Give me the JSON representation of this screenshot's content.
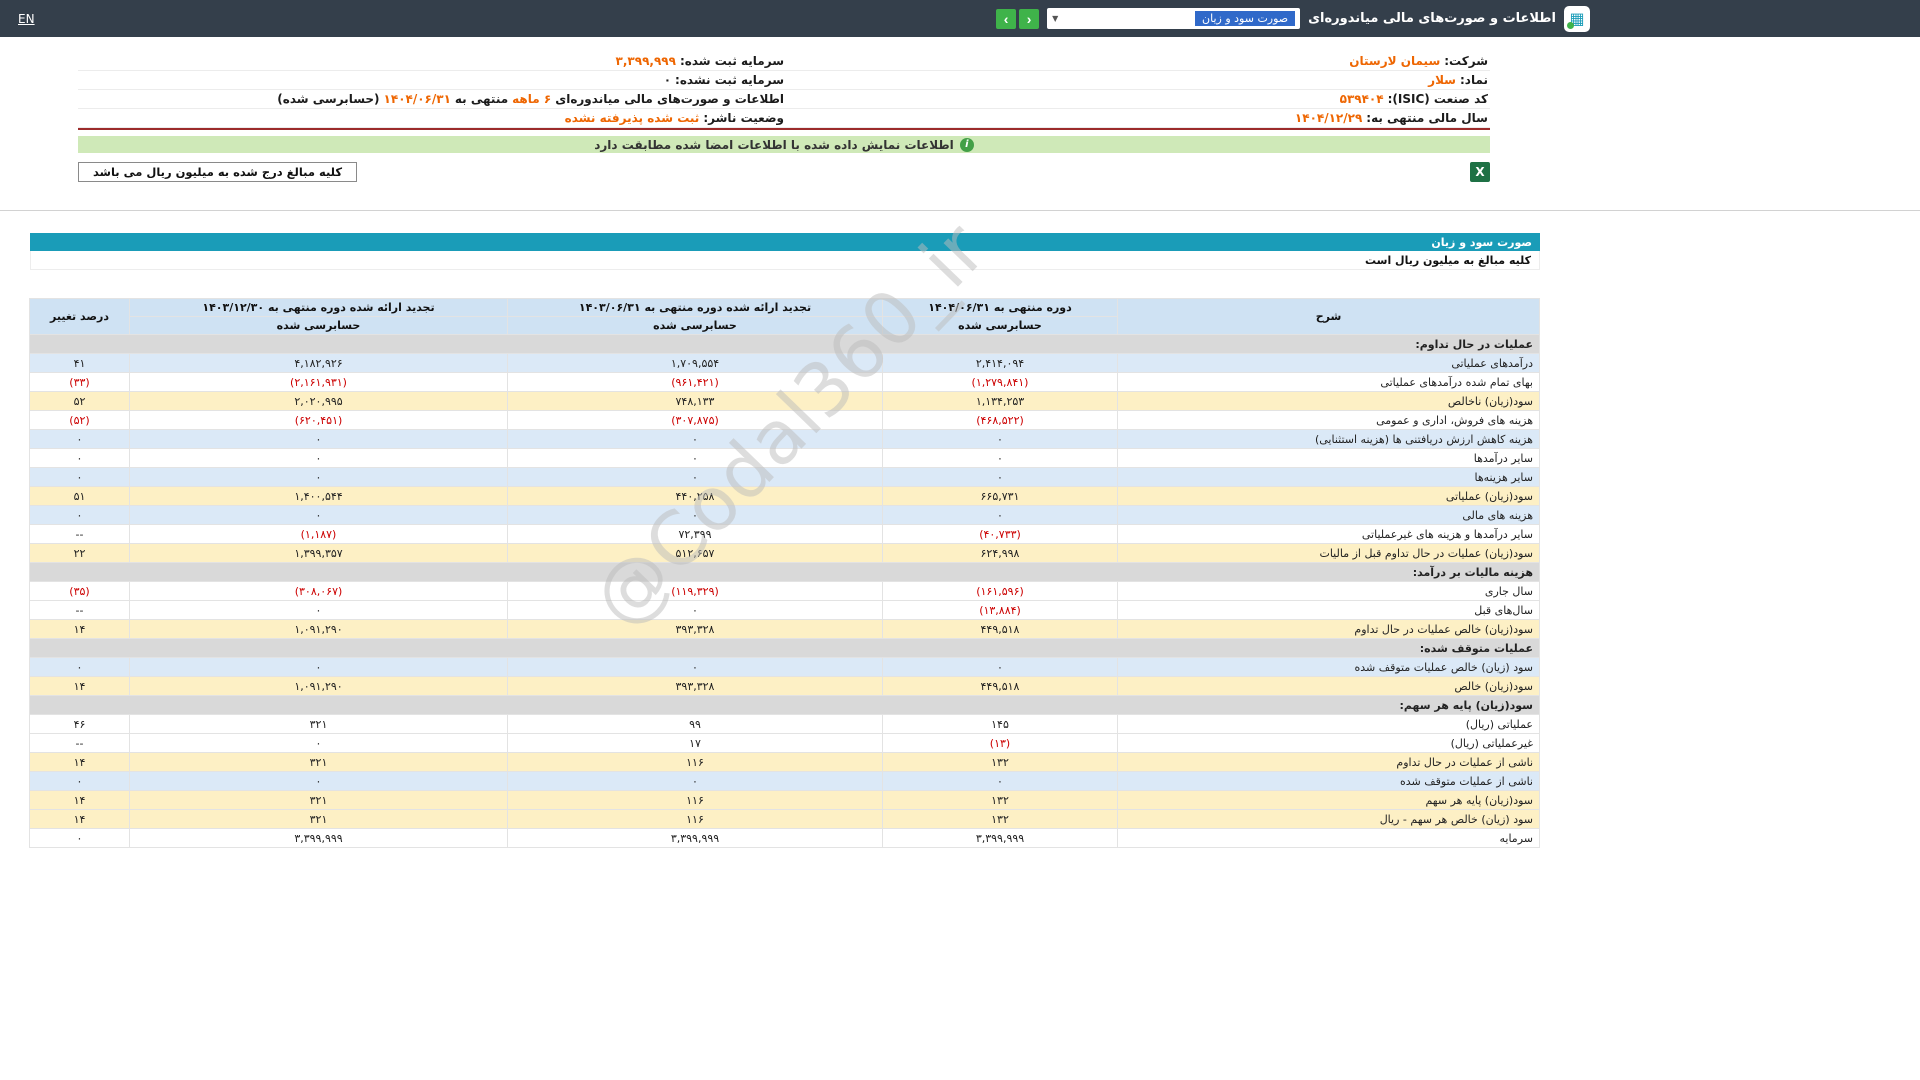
{
  "colors": {
    "navbar_bg": "#343f4b",
    "button_green": "#3fb34a",
    "title_bar_teal": "#1a9cb8",
    "header_blue": "#cfe2f3",
    "row_blue": "#dbe9f7",
    "row_yellow": "#fdf0c5",
    "section_gray": "#d9d9d9",
    "negative_red": "#cc0000",
    "value_orange": "#ee6602",
    "banner_green": "#cfe9b8",
    "banner_icon_green": "#43a047",
    "excel_green": "#1e7145",
    "info_underline_red": "#9c2b2b",
    "select_highlight_blue": "#3069c9"
  },
  "navbar": {
    "en_label": "EN",
    "title": "اطلاعات و صورت‌های مالی میاندوره‌ای",
    "dropdown": {
      "value": "صورت سود و زیان",
      "caret_icon": "▼"
    },
    "nav_buttons": {
      "back_icon": "‹",
      "forward_icon": "›"
    },
    "logo_icon_glyph": "▦"
  },
  "company_info": {
    "right_column": [
      {
        "name": "company",
        "segments": [
          {
            "style": "label",
            "text": "شرکت:"
          },
          {
            "style": "orange",
            "text": "سیمان لارستان"
          }
        ]
      },
      {
        "name": "symbol",
        "segments": [
          {
            "style": "label",
            "text": "نماد:"
          },
          {
            "style": "orange",
            "text": "سلار"
          }
        ]
      },
      {
        "name": "isic-code",
        "segments": [
          {
            "style": "label",
            "text": "کد صنعت (ISIC):"
          },
          {
            "style": "orange",
            "text": "۵۳۹۴۰۴"
          }
        ]
      },
      {
        "name": "fiscal-year-end",
        "segments": [
          {
            "style": "label",
            "text": "سال مالی منتهی به:"
          },
          {
            "style": "orange",
            "text": "۱۴۰۴/۱۲/۲۹"
          }
        ]
      }
    ],
    "left_column": [
      {
        "name": "registered-capital",
        "segments": [
          {
            "style": "label",
            "text": "سرمایه ثبت شده:"
          },
          {
            "style": "orange",
            "text": "۳,۳۹۹,۹۹۹"
          }
        ]
      },
      {
        "name": "unregistered-capital",
        "segments": [
          {
            "style": "label",
            "text": "سرمایه ثبت نشده:"
          },
          {
            "style": "dark",
            "text": "۰"
          }
        ]
      },
      {
        "name": "period-info",
        "segments": [
          {
            "style": "label",
            "text": "اطلاعات و صورت‌های مالی میاندوره‌ای"
          },
          {
            "style": "orange",
            "text": "۶ ماهه"
          },
          {
            "style": "label",
            "text": "منتهی به"
          },
          {
            "style": "orange",
            "text": "۱۴۰۴/۰۶/۳۱"
          },
          {
            "style": "label",
            "text": "(حسابرسی شده)"
          }
        ]
      },
      {
        "name": "publisher-status",
        "segments": [
          {
            "style": "label",
            "text": "وضعیت ناشر:"
          },
          {
            "style": "orange",
            "text": "ثبت شده پذیرفته نشده"
          }
        ]
      }
    ]
  },
  "signature_banner": {
    "info_icon": "i",
    "text": "اطلاعات نمایش داده شده با اطلاعات امضا شده مطابقت دارد"
  },
  "unit_note": {
    "text": "کلیه مبالغ درج شده به میلیون ریال می باشد"
  },
  "excel_export": {
    "icon_label": "X"
  },
  "statement": {
    "title": "صورت سود و زیان",
    "units_note": "کلیه مبالغ به میلیون ریال است",
    "watermark": "@Codal360_ir",
    "table": {
      "col_headers": {
        "desc": "شرح",
        "periods": [
          {
            "title": "دوره منتهی به ۱۴۰۴/۰۶/۳۱",
            "sub": "حسابرسی شده"
          },
          {
            "title": "تجدید ارائه شده دوره منتهی به ۱۴۰۳/۰۶/۳۱",
            "sub": "حسابرسی شده"
          },
          {
            "title": "تجدید ارائه شده دوره منتهی به ۱۴۰۳/۱۲/۳۰",
            "sub": "حسابرسی شده"
          }
        ],
        "change": "درصد تغییر"
      },
      "rows": [
        {
          "type": "section",
          "desc": "عملیات در حال تداوم:"
        },
        {
          "type": "data",
          "style": "blue",
          "desc": "درآمدهای عملیاتی",
          "values": [
            {
              "t": "۲,۴۱۴,۰۹۴"
            },
            {
              "t": "۱,۷۰۹,۵۵۴"
            },
            {
              "t": "۴,۱۸۲,۹۲۶"
            }
          ],
          "change": {
            "t": "۴۱"
          }
        },
        {
          "type": "data",
          "style": "white",
          "desc": "بهای تمام شده درآمدهای عملیاتی",
          "values": [
            {
              "t": "(۱,۲۷۹,۸۴۱)",
              "neg": true
            },
            {
              "t": "(۹۶۱,۴۲۱)",
              "neg": true
            },
            {
              "t": "(۲,۱۶۱,۹۳۱)",
              "neg": true
            }
          ],
          "change": {
            "t": "(۳۳)",
            "neg": true
          }
        },
        {
          "type": "data",
          "style": "yellow",
          "desc": "سود(زیان) ناخالص",
          "values": [
            {
              "t": "۱,۱۳۴,۲۵۳"
            },
            {
              "t": "۷۴۸,۱۳۳"
            },
            {
              "t": "۲,۰۲۰,۹۹۵"
            }
          ],
          "change": {
            "t": "۵۲"
          }
        },
        {
          "type": "data",
          "style": "white",
          "desc": "هزینه های فروش، اداری و عمومی",
          "values": [
            {
              "t": "(۴۶۸,۵۲۲)",
              "neg": true
            },
            {
              "t": "(۳۰۷,۸۷۵)",
              "neg": true
            },
            {
              "t": "(۶۲۰,۴۵۱)",
              "neg": true
            }
          ],
          "change": {
            "t": "(۵۲)",
            "neg": true
          }
        },
        {
          "type": "data",
          "style": "blue",
          "desc": "هزینه کاهش ارزش دریافتنی ها (هزینه استثنایی)",
          "values": [
            {
              "t": "۰"
            },
            {
              "t": "۰"
            },
            {
              "t": "۰"
            }
          ],
          "change": {
            "t": "۰"
          }
        },
        {
          "type": "data",
          "style": "white",
          "desc": "سایر درآمدها",
          "values": [
            {
              "t": "۰"
            },
            {
              "t": "۰"
            },
            {
              "t": "۰"
            }
          ],
          "change": {
            "t": "۰"
          }
        },
        {
          "type": "data",
          "style": "blue",
          "desc": "سایر هزینه‌ها",
          "values": [
            {
              "t": "۰"
            },
            {
              "t": "۰"
            },
            {
              "t": "۰"
            }
          ],
          "change": {
            "t": "۰"
          }
        },
        {
          "type": "data",
          "style": "yellow",
          "desc": "سود(زیان) عملیاتی",
          "values": [
            {
              "t": "۶۶۵,۷۳۱"
            },
            {
              "t": "۴۴۰,۲۵۸"
            },
            {
              "t": "۱,۴۰۰,۵۴۴"
            }
          ],
          "change": {
            "t": "۵۱"
          }
        },
        {
          "type": "data",
          "style": "blue",
          "desc": "هزینه های مالی",
          "values": [
            {
              "t": "۰"
            },
            {
              "t": "۰"
            },
            {
              "t": "۰"
            }
          ],
          "change": {
            "t": "۰"
          }
        },
        {
          "type": "data",
          "style": "white",
          "desc": "سایر درآمدها و هزینه های غیرعملیاتی",
          "values": [
            {
              "t": "(۴۰,۷۳۳)",
              "neg": true
            },
            {
              "t": "۷۲,۳۹۹"
            },
            {
              "t": "(۱,۱۸۷)",
              "neg": true
            }
          ],
          "change": {
            "t": "--"
          }
        },
        {
          "type": "data",
          "style": "yellow",
          "desc": "سود(زیان) عملیات در حال تداوم قبل از مالیات",
          "values": [
            {
              "t": "۶۲۴,۹۹۸"
            },
            {
              "t": "۵۱۲,۶۵۷"
            },
            {
              "t": "۱,۳۹۹,۳۵۷"
            }
          ],
          "change": {
            "t": "۲۲"
          }
        },
        {
          "type": "section",
          "desc": "هزینه مالیات بر درآمد:"
        },
        {
          "type": "data",
          "style": "white",
          "desc": "سال جاری",
          "values": [
            {
              "t": "(۱۶۱,۵۹۶)",
              "neg": true
            },
            {
              "t": "(۱۱۹,۳۲۹)",
              "neg": true
            },
            {
              "t": "(۳۰۸,۰۶۷)",
              "neg": true
            }
          ],
          "change": {
            "t": "(۳۵)",
            "neg": true
          }
        },
        {
          "type": "data",
          "style": "white",
          "desc": "سال‌های قبل",
          "values": [
            {
              "t": "(۱۳,۸۸۴)",
              "neg": true
            },
            {
              "t": "۰"
            },
            {
              "t": "۰"
            }
          ],
          "change": {
            "t": "--"
          }
        },
        {
          "type": "data",
          "style": "yellow",
          "desc": "سود(زیان) خالص عملیات در حال تداوم",
          "values": [
            {
              "t": "۴۴۹,۵۱۸"
            },
            {
              "t": "۳۹۳,۳۲۸"
            },
            {
              "t": "۱,۰۹۱,۲۹۰"
            }
          ],
          "change": {
            "t": "۱۴"
          }
        },
        {
          "type": "section",
          "desc": "عملیات متوقف شده:"
        },
        {
          "type": "data",
          "style": "blue",
          "desc": "سود (زیان) خالص عملیات متوقف شده",
          "values": [
            {
              "t": "۰"
            },
            {
              "t": "۰"
            },
            {
              "t": "۰"
            }
          ],
          "change": {
            "t": "۰"
          }
        },
        {
          "type": "data",
          "style": "yellow",
          "desc": "سود(زیان) خالص",
          "values": [
            {
              "t": "۴۴۹,۵۱۸"
            },
            {
              "t": "۳۹۳,۳۲۸"
            },
            {
              "t": "۱,۰۹۱,۲۹۰"
            }
          ],
          "change": {
            "t": "۱۴"
          }
        },
        {
          "type": "section",
          "desc": "سود(زیان) پایه هر سهم:"
        },
        {
          "type": "data",
          "style": "white",
          "desc": "عملیاتی (ریال)",
          "values": [
            {
              "t": "۱۴۵"
            },
            {
              "t": "۹۹"
            },
            {
              "t": "۳۲۱"
            }
          ],
          "change": {
            "t": "۴۶"
          }
        },
        {
          "type": "data",
          "style": "white",
          "desc": "غیرعملیاتی (ریال)",
          "values": [
            {
              "t": "(۱۳)",
              "neg": true
            },
            {
              "t": "۱۷"
            },
            {
              "t": "۰"
            }
          ],
          "change": {
            "t": "--"
          }
        },
        {
          "type": "data",
          "style": "yellow",
          "desc": "ناشی از عملیات در حال تداوم",
          "values": [
            {
              "t": "۱۳۲"
            },
            {
              "t": "۱۱۶"
            },
            {
              "t": "۳۲۱"
            }
          ],
          "change": {
            "t": "۱۴"
          }
        },
        {
          "type": "data",
          "style": "blue",
          "desc": "ناشی از عملیات متوقف شده",
          "values": [
            {
              "t": "۰"
            },
            {
              "t": "۰"
            },
            {
              "t": "۰"
            }
          ],
          "change": {
            "t": "۰"
          }
        },
        {
          "type": "data",
          "style": "yellow",
          "desc": "سود(زیان) پایه هر سهم",
          "values": [
            {
              "t": "۱۳۲"
            },
            {
              "t": "۱۱۶"
            },
            {
              "t": "۳۲۱"
            }
          ],
          "change": {
            "t": "۱۴"
          }
        },
        {
          "type": "data",
          "style": "yellow",
          "desc": "سود (زیان) خالص هر سهم - ریال",
          "values": [
            {
              "t": "۱۳۲"
            },
            {
              "t": "۱۱۶"
            },
            {
              "t": "۳۲۱"
            }
          ],
          "change": {
            "t": "۱۴"
          }
        },
        {
          "type": "data",
          "style": "white",
          "desc": "سرمایه",
          "values": [
            {
              "t": "۳,۳۹۹,۹۹۹"
            },
            {
              "t": "۳,۳۹۹,۹۹۹"
            },
            {
              "t": "۳,۳۹۹,۹۹۹"
            }
          ],
          "change": {
            "t": "۰"
          }
        }
      ]
    }
  }
}
